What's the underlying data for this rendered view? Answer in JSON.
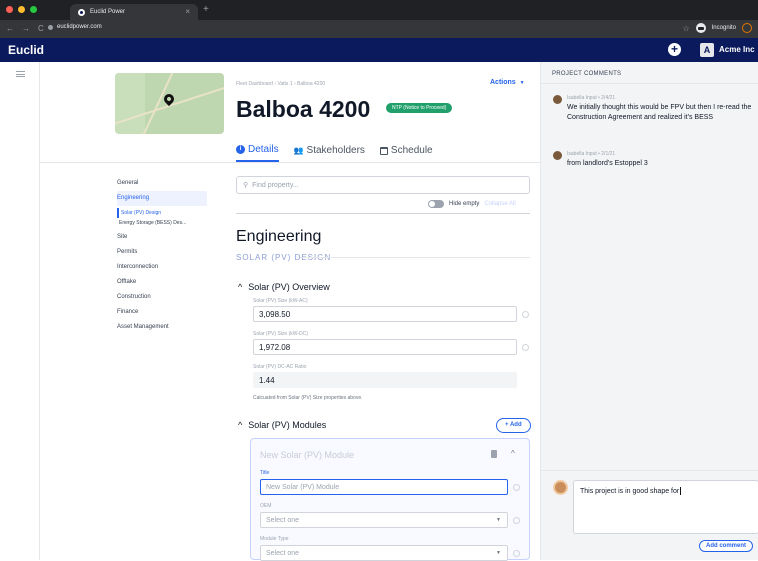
{
  "browser": {
    "tab_title": "Euclid Power",
    "url": "euclidpower.com",
    "profile_label": "Incognito",
    "dot_colors": [
      "#ff5f57",
      "#febc2e",
      "#28c840"
    ]
  },
  "app": {
    "brand": "Euclid",
    "org_initial": "A",
    "org_name": "Acme Inc"
  },
  "project": {
    "breadcrumb": "Fleet Dashboard › Vatts 1 › Balboa 4200",
    "title": "Balboa 4200",
    "status_badge": "NTP (Notice to Proceed)",
    "actions_label": "Actions"
  },
  "tabs": [
    {
      "label": "Details",
      "active": true
    },
    {
      "label": "Stakeholders",
      "active": false
    },
    {
      "label": "Schedule",
      "active": false
    }
  ],
  "leftnav": {
    "items": [
      "General",
      "Engineering",
      "Site",
      "Permits",
      "Interconnection",
      "Offtake",
      "Construction",
      "Finance",
      "Asset Management"
    ],
    "sub_items": [
      "Solar (PV) Design",
      "Energy Storage (BESS) Des..."
    ]
  },
  "search": {
    "placeholder": "Find property...",
    "hide_empty": "Hide empty",
    "collapse_all": "Collapse All"
  },
  "section": {
    "title": "Engineering",
    "subtitle": "SOLAR (PV) DESIGN",
    "overview_title": "Solar (PV) Overview",
    "fields": [
      {
        "label": "Solar (PV) Size (kW-AC)",
        "value": "3,098.50"
      },
      {
        "label": "Solar (PV) Size (kW-DC)",
        "value": "1,972.08"
      },
      {
        "label": "Solar (PV) DC-AC Ratio",
        "value": "1.44"
      }
    ],
    "note": "Calcuated from Solar (PV) Size properties above.",
    "modules_title": "Solar (PV) Modules",
    "add_label": "+ Add"
  },
  "module_card": {
    "title": "New Solar (PV) Module",
    "title_label": "Title",
    "title_placeholder": "New Solar (PV) Module",
    "oem_label": "OEM",
    "oem_value": "Select one",
    "type_label": "Module Type",
    "type_value": "Select one"
  },
  "comments": {
    "header": "PROJECT COMMENTS",
    "items": [
      {
        "meta": "Isabella Input • 2/4/21",
        "text": "We initially thought this would be FPV but then I re-read the Construction Agreement and realized it's BESS"
      },
      {
        "meta": "Isabella Input • 2/1/21",
        "text": "from landlord's Estoppel 3"
      }
    ],
    "draft": "This project is in good shape for",
    "submit_label": "Add comment"
  }
}
